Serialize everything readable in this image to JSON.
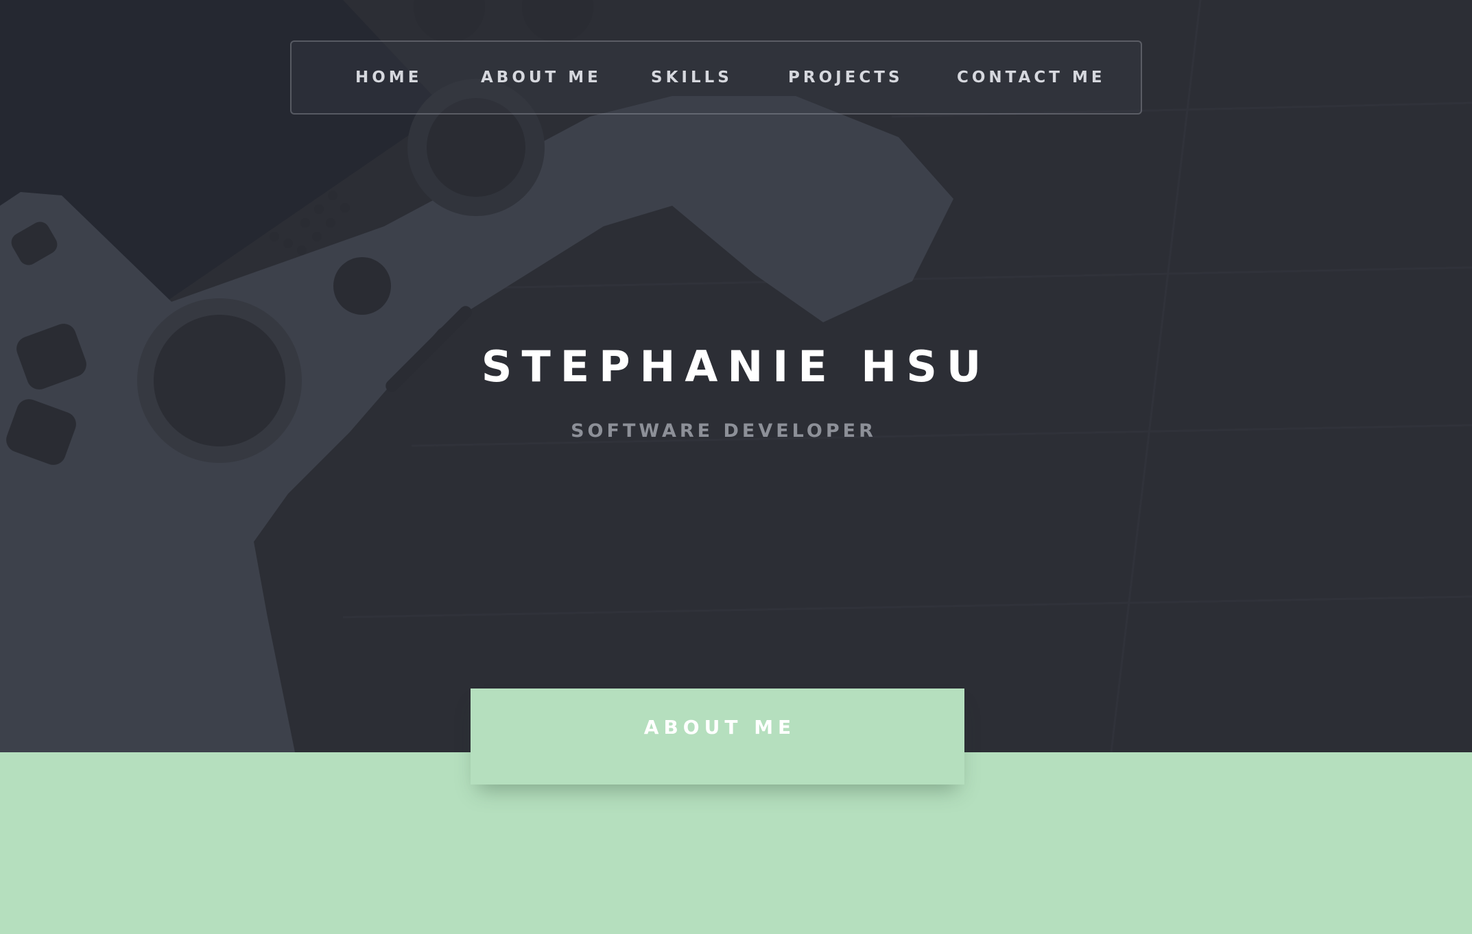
{
  "nav": {
    "items": [
      {
        "label": "HOME"
      },
      {
        "label": "ABOUT ME"
      },
      {
        "label": "SKILLS"
      },
      {
        "label": "PROJECTS"
      },
      {
        "label": "CONTACT ME"
      }
    ]
  },
  "hero": {
    "title": "STEPHANIE HSU",
    "subtitle": "SOFTWARE DEVELOPER",
    "background_image": "game-controller-on-wooden-table"
  },
  "about": {
    "tab_label": "ABOUT ME"
  },
  "colors": {
    "hero_overlay": "#2d2f36",
    "accent_green": "#b5dfbe",
    "nav_text": "#d6d8de",
    "subtitle_text": "#8d9098"
  }
}
